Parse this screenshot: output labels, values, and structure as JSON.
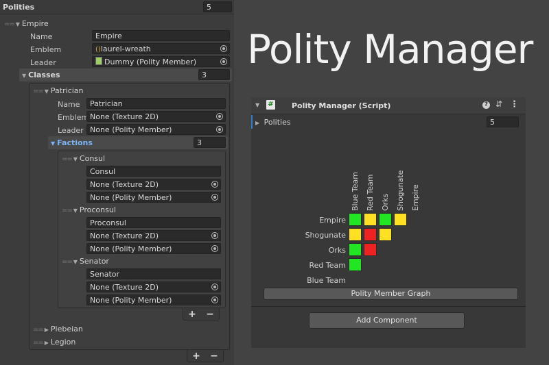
{
  "left": {
    "polities_label": "Polities",
    "polities_count": "5",
    "empire": {
      "header": "Empire",
      "name_label": "Name",
      "name_value": "Empire",
      "emblem_label": "Emblem",
      "emblem_value": "laurel-wreath",
      "leader_label": "Leader",
      "leader_value": "Dummy (Polity Member)",
      "classes_label": "Classes",
      "classes_count": "3"
    },
    "patrician": {
      "header": "Patrician",
      "name_label": "Name",
      "name_value": "Patrician",
      "emblem_label": "Emblem",
      "emblem_value": "None (Texture 2D)",
      "leader_label": "Leader",
      "leader_value": "None (Polity Member)",
      "factions_label": "Factions",
      "factions_count": "3"
    },
    "factions": [
      {
        "header": "Consul",
        "name": "Consul",
        "emblem": "None (Texture 2D)",
        "leader": "None (Polity Member)"
      },
      {
        "header": "Proconsul",
        "name": "Proconsul",
        "emblem": "None (Texture 2D)",
        "leader": "None (Polity Member)"
      },
      {
        "header": "Senator",
        "name": "Senator",
        "emblem": "None (Texture 2D)",
        "leader": "None (Polity Member)"
      }
    ],
    "other_classes": [
      "Plebeian",
      "Legion"
    ],
    "plus": "+",
    "minus": "−"
  },
  "title": "Polity Manager",
  "inspector": {
    "component_title": "Polity Manager (Script)",
    "polities_label": "Polities",
    "polities_count": "5",
    "graph": {
      "columns": [
        "Blue Team",
        "Red Team",
        "Orks",
        "Shogunate",
        "Empire"
      ],
      "rows": [
        "Empire",
        "Shogunate",
        "Orks",
        "Red Team",
        "Blue Team"
      ],
      "cells": [
        [
          "green",
          "yellow",
          "green",
          "yellow"
        ],
        [
          "yellow",
          "red",
          "yellow"
        ],
        [
          "green",
          "red"
        ],
        [
          "green"
        ],
        []
      ]
    },
    "graph_button": "Polity Member Graph",
    "add_component": "Add Component"
  },
  "colors": {
    "green": "#22e622",
    "yellow": "#ffe022",
    "red": "#ee2222",
    "accent_blue": "#7bb3f4"
  }
}
